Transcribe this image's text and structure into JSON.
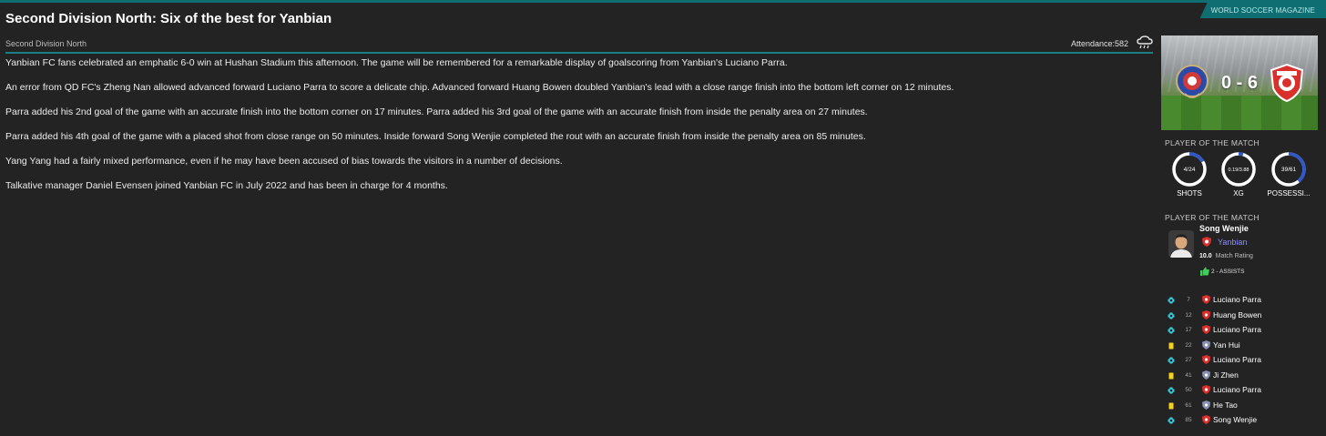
{
  "header": {
    "magazine": "WORLD SOCCER MAGAZINE",
    "headline": "Second Division North: Six of the best for Yanbian",
    "competition": "Second Division North",
    "attendance_label": "Attendance:",
    "attendance_value": "582",
    "weather_icon": "cloud-rain-icon"
  },
  "article": {
    "p1": "Yanbian FC fans celebrated an emphatic 6-0 win at Hushan Stadium this afternoon. The game will be remembered for a remarkable display of goalscoring from Yanbian's Luciano Parra.",
    "p2": "An error from QD FC's Zheng Nan allowed advanced forward Luciano Parra to score a delicate chip. Advanced forward Huang Bowen doubled Yanbian's lead with a close range finish into the bottom left corner on 12 minutes.",
    "p3": "Parra added his 2nd goal of the game with an accurate finish into the bottom corner on 17 minutes. Parra added his 3rd goal of the game with an accurate finish from inside the penalty area on 27 minutes.",
    "p4": "Parra added his 4th goal of the game with a placed shot from close range on 50 minutes. Inside forward Song Wenjie completed the rout with an accurate finish from inside the penalty area on 85 minutes.",
    "p5": "Yang Yang had a fairly mixed performance, even if he may have been accused of bias towards the visitors in a number of decisions.",
    "p6": "Talkative manager Daniel Evensen joined Yanbian FC in July 2022 and has been in charge for 4 months."
  },
  "scoreboard": {
    "score": "0 - 6",
    "home_color": "#2b4aa8",
    "away_color": "#d9302c"
  },
  "stats": {
    "title": "PLAYER OF THE MATCH",
    "items": [
      {
        "label": "SHOTS",
        "value": "4/24",
        "fraction": 0.1667
      },
      {
        "label": "XG",
        "value": "0.19/3.88",
        "fraction": 0.0467
      },
      {
        "label": "POSSESSI...",
        "value": "39/61",
        "fraction": 0.39
      }
    ]
  },
  "potm": {
    "title": "PLAYER OF THE MATCH",
    "name": "Song Wenjie",
    "club": "Yanbian",
    "rating": "10.0",
    "rating_label": "Match Rating",
    "assists": "2 - ASSISTS"
  },
  "events": [
    {
      "type": "goal",
      "minute": "7",
      "team": "away",
      "player": "Luciano Parra"
    },
    {
      "type": "goal",
      "minute": "12",
      "team": "away",
      "player": "Huang Bowen"
    },
    {
      "type": "goal",
      "minute": "17",
      "team": "away",
      "player": "Luciano Parra"
    },
    {
      "type": "yellow-card",
      "minute": "22",
      "team": "home",
      "player": "Yan Hui"
    },
    {
      "type": "goal",
      "minute": "27",
      "team": "away",
      "player": "Luciano Parra"
    },
    {
      "type": "yellow-card",
      "minute": "41",
      "team": "home",
      "player": "Ji Zhen"
    },
    {
      "type": "goal",
      "minute": "50",
      "team": "away",
      "player": "Luciano Parra"
    },
    {
      "type": "yellow-card",
      "minute": "61",
      "team": "home",
      "player": "He Tao"
    },
    {
      "type": "goal",
      "minute": "85",
      "team": "away",
      "player": "Song Wenjie"
    }
  ]
}
